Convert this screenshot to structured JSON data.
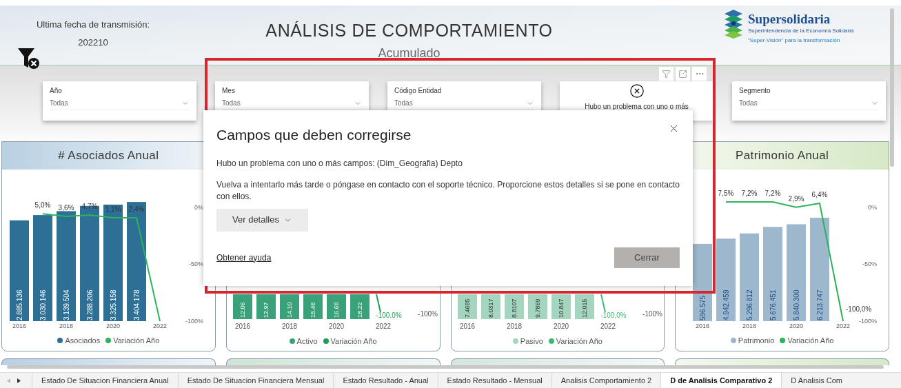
{
  "header": {
    "transmission_label": "Ultima fecha de transmisión:",
    "transmission_value": "202210",
    "title": "ANÁLISIS DE COMPORTAMIENTO",
    "subtitle": "Acumulado",
    "logo": {
      "name": "Supersolidaria",
      "tagline": "Superintendencia de la Economía Solidaria",
      "slogan": "\"Super-Visión\" para la transformación"
    }
  },
  "slicers": [
    {
      "kind": "dropdown",
      "label": "Año",
      "value": "Todas"
    },
    {
      "kind": "dropdown",
      "label": "Mes",
      "value": "Todas"
    },
    {
      "kind": "dropdown",
      "label": "Código Entidad",
      "value": "Todas"
    },
    {
      "kind": "error",
      "message": "Hubo un problema con uno o más"
    },
    {
      "kind": "dropdown",
      "label": "Segmento",
      "value": "Todas"
    }
  ],
  "charts": [
    {
      "kind": "full",
      "title": "# Asociados Anual",
      "bar_labels": [
        "2.885.136",
        "3.030.146",
        "3.139.504",
        "3.288.206",
        "3.325.158",
        "3.404.178"
      ],
      "line_labels": [
        "5,0%",
        "3,6%",
        "4,7%",
        "1,1%",
        "2,4%"
      ],
      "xticks": [
        "2016",
        "2018",
        "2020",
        "2022"
      ],
      "axis_labels": [
        "0%",
        "-50%",
        "-100%"
      ],
      "legend": [
        {
          "name": "Asociados",
          "color": "#2e6f96"
        },
        {
          "name": "Variación Año",
          "color": "#2bb55a"
        }
      ]
    },
    {
      "kind": "partial",
      "bar_labels": [
        "12.06",
        "12.97",
        "14.10",
        "15.46",
        "16.68",
        "18.22"
      ],
      "end_label": "-100,0%",
      "axis_label": "-100%",
      "xticks": [
        "2016",
        "2018",
        "2020",
        "2022"
      ],
      "legend": [
        {
          "name": "Activo",
          "color": "#3aa27a"
        },
        {
          "name": "Variación Año",
          "color": "#1f9e55"
        }
      ]
    },
    {
      "kind": "partial",
      "bar_labels": [
        "7.4685",
        "8.0317",
        "8.8107",
        "9.7869",
        "10.847",
        "12.015"
      ],
      "end_label": "-100,0%",
      "axis_label": "-100%",
      "xticks": [
        "2016",
        "2018",
        "2020",
        "2022"
      ],
      "legend": [
        {
          "name": "Pasivo",
          "color": "#a3d5bf"
        },
        {
          "name": "Variación Año",
          "color": "#3dba7a"
        }
      ]
    },
    {
      "kind": "full",
      "title": "Patrimonio Anual",
      "bar_labels": [
        "596.575",
        "4.942.459",
        "5.296.812",
        "5.676.451",
        "5.840.300",
        "6.213.747"
      ],
      "line_labels": [
        "7,5%",
        "7,2%",
        "7,2%",
        "2,9%",
        "6,4%",
        "-100,0%"
      ],
      "xticks": [
        "2016",
        "2018",
        "2020",
        "2022"
      ],
      "axis_labels": [
        "0%",
        "-50%",
        "-100%"
      ],
      "legend": [
        {
          "name": "Patrimonio",
          "color": "#9db7cc"
        },
        {
          "name": "Variación Año",
          "color": "#2bb55a"
        }
      ]
    }
  ],
  "dialog": {
    "title": "Campos que deben corregirse",
    "message": "Hubo un problema con uno o más campos: (Dim_Geografia) Depto",
    "detail": "Vuelva a intentarlo más tarde o póngase en contacto con el soporte técnico. Proporcione estos detalles si se pone en contacto con ellos.",
    "details_button": "Ver detalles",
    "help_link": "Obtener ayuda",
    "close_button": "Cerrar"
  },
  "tabs": [
    {
      "label": "Estado De Situacion Financiera Anual",
      "selected": false
    },
    {
      "label": "Estado De Situacion Financiera Mensual",
      "selected": false
    },
    {
      "label": "Estado Resultado - Anual",
      "selected": false
    },
    {
      "label": "Estado Resultado - Mensual",
      "selected": false
    },
    {
      "label": "Analisis Comportamiento 2",
      "selected": false
    },
    {
      "label": "D de Analisis Comparativo 2",
      "selected": true
    },
    {
      "label": "D Analisis Com",
      "selected": false
    }
  ]
}
